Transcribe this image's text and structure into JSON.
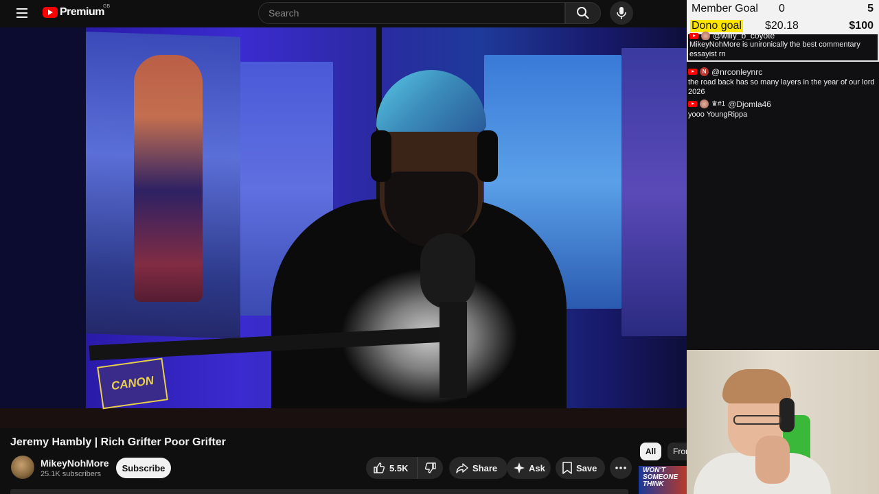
{
  "masthead": {
    "logo_text": "Premium",
    "region": "GB",
    "search_placeholder": "Search"
  },
  "video": {
    "badge_text": "CANON",
    "title": "Jeremy Hambly | Rich Grifter Poor Grifter"
  },
  "channel": {
    "name": "MikeyNohMore",
    "subscribers": "25.1K subscribers",
    "subscribe_label": "Subscribe"
  },
  "actions": {
    "like_count": "5.5K",
    "share_label": "Share",
    "ask_label": "Ask",
    "save_label": "Save"
  },
  "chips": {
    "all": "All",
    "from": "From"
  },
  "recommendation": {
    "thumb_text": "WON'T SOMEONE THINK"
  },
  "goals": {
    "member": {
      "label": "Member Goal",
      "current": "0",
      "target": "5"
    },
    "dono": {
      "label": "Dono goal",
      "current": "$20.18",
      "target": "$100"
    }
  },
  "chat": [
    {
      "user": "@willy_b_coyote",
      "text": "MikeyNohMore is unironically the best commentary essayist rn",
      "avatar": "",
      "boxed": true
    },
    {
      "user": "@nrconleynrc",
      "text": "the road back has so many layers in the year of our lord 2026",
      "avatar": "N",
      "boxed": false
    },
    {
      "user": "@Djomla46",
      "text": "yooo YoungRippa",
      "avatar": "",
      "badge": "#1",
      "boxed": false
    }
  ],
  "colors": {
    "brand_red": "#ff0000",
    "highlight_yellow": "#ffe600",
    "background": "#0f0f0f",
    "pill_bg": "#272727"
  }
}
